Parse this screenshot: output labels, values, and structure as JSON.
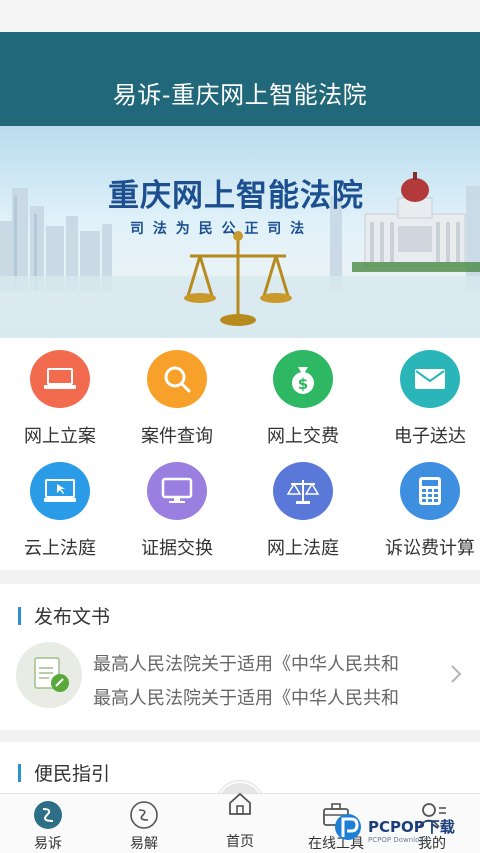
{
  "header": {
    "title": "易诉-重庆网上智能法院"
  },
  "banner": {
    "title": "重庆网上智能法院",
    "slogan": "司 法 为 民    公 正 司 法"
  },
  "services": [
    {
      "label": "网上立案",
      "icon": "laptop-icon",
      "color": "#f26b4e"
    },
    {
      "label": "案件查询",
      "icon": "magnifier-icon",
      "color": "#f7a12a"
    },
    {
      "label": "网上交费",
      "icon": "money-bag-icon",
      "color": "#2fb863"
    },
    {
      "label": "电子送达",
      "icon": "envelope-icon",
      "color": "#2ab5b8"
    },
    {
      "label": "云上法庭",
      "icon": "monitor-cursor-icon",
      "color": "#2a9be6"
    },
    {
      "label": "证据交换",
      "icon": "screen-icon",
      "color": "#9a7fe0"
    },
    {
      "label": "网上法庭",
      "icon": "scales-icon",
      "color": "#5a78d8"
    },
    {
      "label": "诉讼费计算",
      "icon": "calculator-icon",
      "color": "#3e8fdf"
    }
  ],
  "documents": {
    "title": "发布文书",
    "items": [
      "最高人民法院关于适用《中华人民共和",
      "最高人民法院关于适用《中华人民共和"
    ]
  },
  "guide": {
    "title": "便民指引"
  },
  "tabbar": {
    "items": [
      {
        "label": "易诉",
        "icon": "yisu-logo-icon"
      },
      {
        "label": "易解",
        "icon": "yijie-logo-icon"
      },
      {
        "label": "首页",
        "icon": "home-icon"
      },
      {
        "label": "在线工具",
        "icon": "toolbox-icon"
      },
      {
        "label": "我的",
        "icon": "user-icon"
      }
    ]
  },
  "watermark": {
    "text": "PCPOP下载",
    "sub": "PCPOP Download"
  }
}
